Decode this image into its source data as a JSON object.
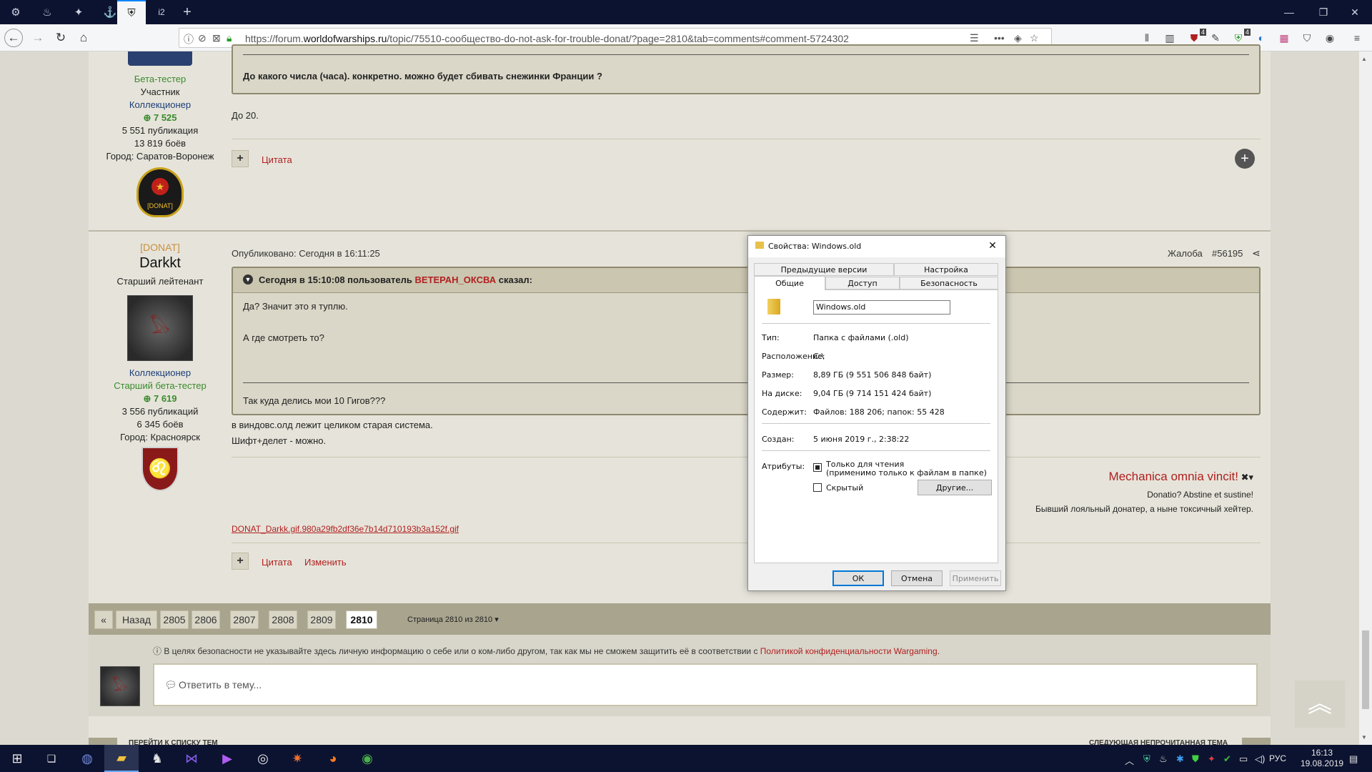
{
  "browser": {
    "tabs": [
      {
        "icon": "wargaming-icon"
      },
      {
        "icon": "steam-icon"
      },
      {
        "icon": "gear-tab-icon"
      },
      {
        "icon": "ship-icon"
      },
      {
        "icon": "shield-tab-icon"
      },
      {
        "icon": "tab-icon",
        "label": "i2"
      }
    ],
    "new_tab": "+",
    "url_prefix": "https://forum.",
    "url_domain": "worldofwarships.ru",
    "url_rest": "/topic/75510-сообщество-do-not-ask-for-trouble-donat/?page=2810&tab=comments#comment-5724302",
    "toolbar_badges": {
      "ublock": "4",
      "shield": "4"
    }
  },
  "post1": {
    "rank1": "Бета-тестер",
    "rank2": "Участник",
    "rank3": "Коллекционер",
    "reputation": "7 525",
    "posts": "5 551 публикация",
    "battles": "13 819 боёв",
    "city": "Город: Саратов-Воронеж",
    "badge_text": "[DONAT]",
    "quote_text": "До какого числа (часа). конкретно. можно будет сбивать снежинки Франции ?",
    "body": "До 20.",
    "quote_btn": "Цитата"
  },
  "post2": {
    "clan": "[DONAT]",
    "username": "Darkkt",
    "title": "Старший лейтенант",
    "rank1": "Коллекционер",
    "rank2": "Старший бета-тестер",
    "reputation": "7 619",
    "posts": "3 556 публикаций",
    "battles": "6 345 боёв",
    "city": "Город: Красноярск",
    "published": "Опубликовано: Сегодня в 16:11:25",
    "report": "Жалоба",
    "post_number": "#56195",
    "quote_head_prefix": "Сегодня в 15:10:08 пользователь",
    "quote_author": "ВЕТЕРАН_ОКСВА",
    "quote_head_suffix": "сказал:",
    "quote_line1": "Да? Значит это я туплю.",
    "quote_line2": "А где смотреть то?",
    "quote_line3": "Так куда делись мои 10 Гигов???",
    "body_line1": "в виндовс.олд лежит целиком старая система.",
    "body_line2": "Шифт+делет - можно.",
    "sig_title": "Mechanica omnia vincit!",
    "sig_line1": "Donatio? Abstine et sustine!",
    "sig_line2": "Бывший лояльный донатер, а ныне токсичный хейтер.",
    "attachment": "DONAT_Darkk.gif.980a29fb2df36e7b14d710193b3a152f.gif",
    "quote_btn": "Цитата",
    "edit_btn": "Изменить"
  },
  "pagination": {
    "first": "«",
    "back": "Назад",
    "pages": [
      "2805",
      "2806",
      "2807",
      "2808",
      "2809",
      "2810"
    ],
    "current": "2810",
    "page_info": "Страница 2810 из 2810"
  },
  "privacy": {
    "text": "В целях безопасности не указывайте здесь личную информацию о себе или о ком-либо другом, так как мы не сможем защитить её в соответствии с",
    "link": "Политикой конфиденциальности Wargaming",
    "end": "."
  },
  "reply": {
    "placeholder": "Ответить в тему..."
  },
  "footer": {
    "left": "ПЕРЕЙТИ К СПИСКУ ТЕМ",
    "right": "СЛЕДУЮЩАЯ НЕПРОЧИТАННАЯ ТЕМА"
  },
  "dialog": {
    "title": "Свойства: Windows.old",
    "tabs_row1": [
      "Предыдущие версии",
      "Настройка"
    ],
    "tabs_row2": [
      "Общие",
      "Доступ",
      "Безопасность"
    ],
    "name_value": "Windows.old",
    "rows": [
      {
        "label": "Тип:",
        "value": "Папка с файлами (.old)"
      },
      {
        "label": "Расположение:",
        "value": "C:\\"
      },
      {
        "label": "Размер:",
        "value": "8,89 ГБ (9 551 506 848 байт)"
      },
      {
        "label": "На диске:",
        "value": "9,04 ГБ (9 714 151 424 байт)"
      },
      {
        "label": "Содержит:",
        "value": "Файлов: 188 206; папок: 55 428"
      }
    ],
    "created_label": "Создан:",
    "created_value": "5 июня 2019 г., 2:38:22",
    "attr_label": "Атрибуты:",
    "readonly": "Только для чтения",
    "readonly_note": "(применимо только к файлам в папке)",
    "hidden": "Скрытый",
    "other_btn": "Другие...",
    "ok": "ОК",
    "cancel": "Отмена",
    "apply": "Применить"
  },
  "taskbar": {
    "lang": "РУС",
    "time": "16:13",
    "date": "19.08.2019"
  },
  "colors": {
    "accent_red": "#b02020",
    "accent_green": "#3a8a2e",
    "navy": "#1d3d7a",
    "taskbar": "#0c1330"
  }
}
